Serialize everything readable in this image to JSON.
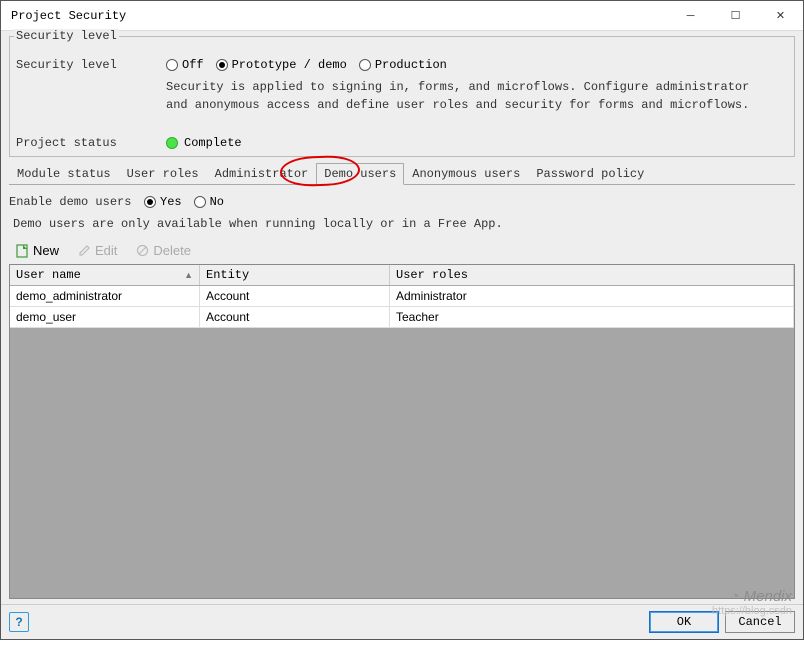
{
  "window": {
    "title": "Project Security"
  },
  "group": {
    "legend": "Security level",
    "security_level": {
      "label": "Security level",
      "options": {
        "off": "Off",
        "demo": "Prototype / demo",
        "prod": "Production"
      },
      "selected": "demo",
      "description": "Security is applied to signing in, forms, and microflows. Configure administrator and anonymous access and define user roles and security for forms and microflows."
    },
    "project_status": {
      "label": "Project status",
      "value": "Complete"
    }
  },
  "tabs": [
    {
      "id": "module_status",
      "label": "Module status"
    },
    {
      "id": "user_roles",
      "label": "User roles"
    },
    {
      "id": "administrator",
      "label": "Administrator"
    },
    {
      "id": "demo_users",
      "label": "Demo users"
    },
    {
      "id": "anonymous_users",
      "label": "Anonymous users"
    },
    {
      "id": "password_policy",
      "label": "Password policy"
    }
  ],
  "active_tab": "demo_users",
  "demo_users": {
    "enable_label": "Enable demo users",
    "yes": "Yes",
    "no": "No",
    "selected": "Yes",
    "note": "Demo users are only available when running locally or in a Free App.",
    "toolbar": {
      "new": "New",
      "edit": "Edit",
      "delete": "Delete"
    },
    "columns": {
      "user": "User name",
      "entity": "Entity",
      "roles": "User roles"
    },
    "rows": [
      {
        "user": "demo_administrator",
        "entity": "Account",
        "roles": "Administrator"
      },
      {
        "user": "demo_user",
        "entity": "Account",
        "roles": "Teacher"
      }
    ]
  },
  "footer": {
    "help": "?",
    "ok": "OK",
    "cancel": "Cancel"
  },
  "watermark": {
    "brand": "Mendix",
    "blog": "https://blog.csdn"
  }
}
